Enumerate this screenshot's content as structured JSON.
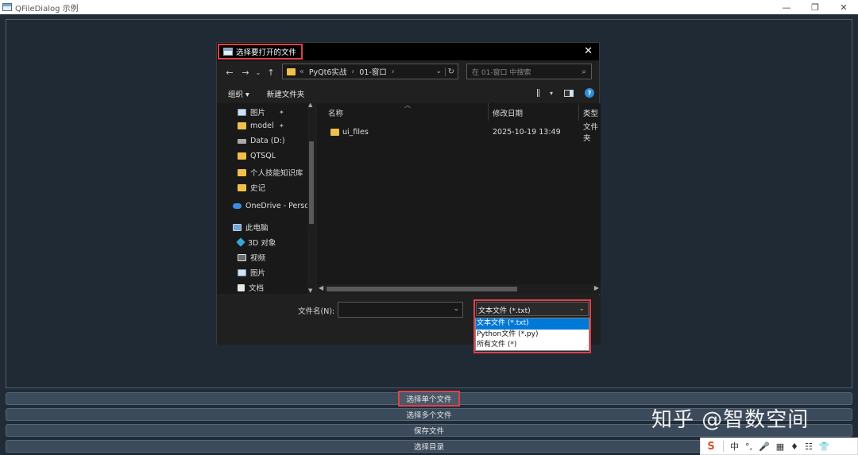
{
  "app": {
    "title": "QFileDialog 示例",
    "min": "—",
    "restore": "❐",
    "close": "✕"
  },
  "dialog": {
    "title": "选择要打开的文件",
    "close": "✕",
    "nav": {
      "back": "←",
      "forward": "→",
      "history": "⌄",
      "up": "↑"
    },
    "address": {
      "prefix": "«",
      "crumbs": [
        "PyQt6实战",
        "01-窗口"
      ],
      "sep": "›",
      "dropdown": "⌄",
      "refresh": "↻"
    },
    "search": {
      "placeholder": "在 01-窗口 中搜索",
      "icon": "⌕"
    },
    "toolbar": {
      "organize": "组织 ▾",
      "new_folder": "新建文件夹",
      "help": "?",
      "view_dd": "▾"
    },
    "navpane": {
      "items": [
        {
          "label": "图片",
          "icon": "pic",
          "pinned": true
        },
        {
          "label": "model",
          "icon": "folder",
          "pinned": true
        },
        {
          "label": "Data (D:)",
          "icon": "drive",
          "pinned": false
        },
        {
          "label": "QTSQL",
          "icon": "folder",
          "pinned": false
        },
        {
          "label": "个人技能知识库",
          "icon": "folder",
          "pinned": false
        },
        {
          "label": "史记",
          "icon": "folder",
          "pinned": false
        },
        {
          "label": "OneDrive - Perso",
          "icon": "cloud",
          "pinned": false
        },
        {
          "label": "此电脑",
          "icon": "pc",
          "pinned": false
        },
        {
          "label": "3D 对象",
          "icon": "cube",
          "pinned": false
        },
        {
          "label": "视频",
          "icon": "vid",
          "pinned": false
        },
        {
          "label": "图片",
          "icon": "pic",
          "pinned": false
        },
        {
          "label": "文档",
          "icon": "doc",
          "pinned": false
        }
      ],
      "pin_glyph": "📌"
    },
    "columns": {
      "name": "名称",
      "date": "修改日期",
      "type": "类型"
    },
    "files": [
      {
        "name": "ui_files",
        "date": "2025-10-19 13:49",
        "type": "文件夹"
      }
    ],
    "filename_label": "文件名(N):",
    "filetype": {
      "selected": "文本文件 (*.txt)",
      "options": [
        "文本文件 (*.txt)",
        "Python文件 (*.py)",
        "所有文件 (*)"
      ]
    }
  },
  "buttons": {
    "single": "选择单个文件",
    "multi": "选择多个文件",
    "save": "保存文件",
    "dir": "选择目录"
  },
  "watermark": "知乎 @智数空间",
  "ime": {
    "logo": "S",
    "items": [
      "中",
      "°,",
      "🎤",
      "▦",
      "♦",
      "☷",
      "👕"
    ]
  }
}
